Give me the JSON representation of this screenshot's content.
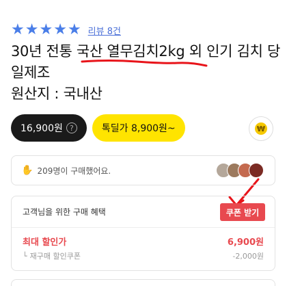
{
  "rating": {
    "stars": [
      "★",
      "★",
      "★",
      "★",
      "★"
    ],
    "review_link": "리뷰 8건"
  },
  "product": {
    "title": "30년 전통 국산 열무김치2kg 외 인기 김치 당일제조",
    "origin": "원산지 : 국내산"
  },
  "price": {
    "regular": "16,900원",
    "special": "톡딜가 8,900원~",
    "help_glyph": "?"
  },
  "coin_glyph": "₩",
  "buyers": {
    "text": "209명이 구매했어요."
  },
  "benefit": {
    "title": "고객님을 위한 구매 혜택",
    "coupon_button": "쿠폰 받기",
    "max_discount_label": "최대 할인가",
    "max_discount_value": "6,900원",
    "repurchase_label": "재구매 할인쿠폰",
    "repurchase_value": "-2,000원"
  },
  "colors": {
    "accent_blue": "#4a7ee8",
    "discount_red": "#e8494f",
    "special_yellow": "#ffe400",
    "annotation_red": "#e8141a"
  }
}
